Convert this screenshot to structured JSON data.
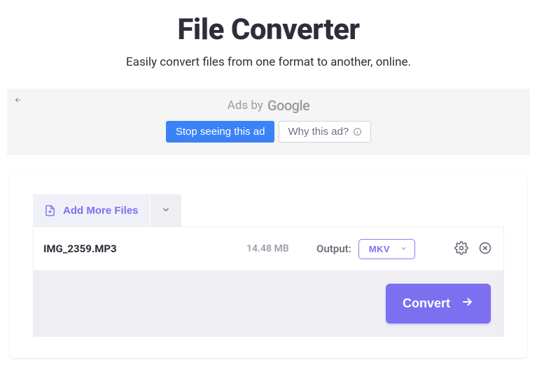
{
  "header": {
    "title": "File Converter",
    "subtitle": "Easily convert files from one format to another, online."
  },
  "ad": {
    "label_prefix": "Ads by",
    "brand": "Google",
    "stop_label": "Stop seeing this ad",
    "why_label": "Why this ad?"
  },
  "toolbar": {
    "add_more_label": "Add More Files"
  },
  "file": {
    "name": "IMG_2359.MP3",
    "size": "14.48 MB",
    "output_label": "Output:",
    "selected_format": "MKV"
  },
  "actions": {
    "convert_label": "Convert"
  },
  "colors": {
    "accent": "#7c6ff0",
    "ad_button": "#3b82f6"
  }
}
